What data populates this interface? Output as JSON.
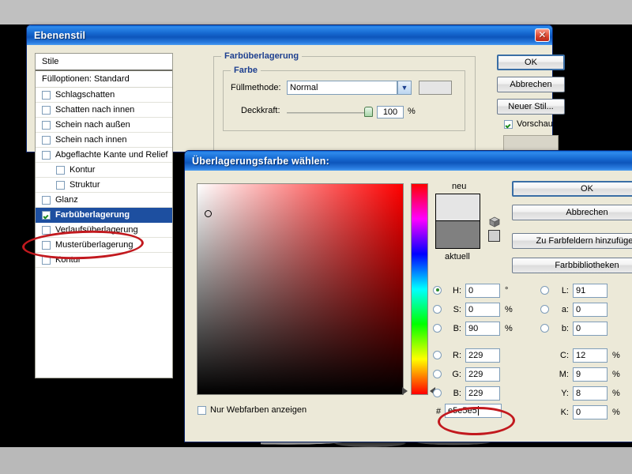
{
  "desktop": {
    "background_color": "#000000",
    "band_color": "#c0c0c0"
  },
  "layer_style_dialog": {
    "title": "Ebenenstil",
    "close_label": "✕",
    "styles_list": {
      "header": "Stile",
      "blending": "Fülloptionen: Standard",
      "items": [
        {
          "label": "Schlagschatten",
          "checked": false,
          "indent": false,
          "selected": false
        },
        {
          "label": "Schatten nach innen",
          "checked": false,
          "indent": false,
          "selected": false
        },
        {
          "label": "Schein nach außen",
          "checked": false,
          "indent": false,
          "selected": false
        },
        {
          "label": "Schein nach innen",
          "checked": false,
          "indent": false,
          "selected": false
        },
        {
          "label": "Abgeflachte Kante und Relief",
          "checked": false,
          "indent": false,
          "selected": false
        },
        {
          "label": "Kontur",
          "checked": false,
          "indent": true,
          "selected": false
        },
        {
          "label": "Struktur",
          "checked": false,
          "indent": true,
          "selected": false
        },
        {
          "label": "Glanz",
          "checked": false,
          "indent": false,
          "selected": false
        },
        {
          "label": "Farbüberlagerung",
          "checked": true,
          "indent": false,
          "selected": true
        },
        {
          "label": "Verlaufsüberlagerung",
          "checked": false,
          "indent": false,
          "selected": false
        },
        {
          "label": "Musterüberlagerung",
          "checked": false,
          "indent": false,
          "selected": false
        },
        {
          "label": "Kontur",
          "checked": false,
          "indent": false,
          "selected": false
        }
      ]
    },
    "panel": {
      "group_title": "Farbüberlagerung",
      "subgroup_title": "Farbe",
      "blend_mode_label": "Füllmethode:",
      "blend_mode_value": "Normal",
      "color_swatch": "#e5e5e5",
      "opacity_label": "Deckkraft:",
      "opacity_value": "100",
      "opacity_unit": "%"
    },
    "buttons": {
      "ok": "OK",
      "cancel": "Abbrechen",
      "new_style": "Neuer Stil...",
      "preview_label": "Vorschau",
      "preview_checked": true
    }
  },
  "color_picker_dialog": {
    "title": "Überlagerungsfarbe wählen:",
    "preview": {
      "new_label": "neu",
      "current_label": "aktuell",
      "new_color": "#e5e5e5",
      "current_color": "#808080",
      "gamut_warning_icon": "cube-icon",
      "gamut_swatch": "#d0d0d0"
    },
    "buttons": {
      "ok": "OK",
      "cancel": "Abbrechen",
      "add_swatch": "Zu Farbfeldern hinzufügen",
      "libraries": "Farbbibliotheken"
    },
    "web_colors_label": "Nur Webfarben anzeigen",
    "web_colors_checked": false,
    "hex_prefix": "#",
    "hex_value": "e5e5e5",
    "fields": [
      {
        "key": "H",
        "label": "H:",
        "value": "0",
        "unit": "°",
        "radio": true,
        "selected": true
      },
      {
        "key": "S",
        "label": "S:",
        "value": "0",
        "unit": "%",
        "radio": true,
        "selected": false
      },
      {
        "key": "B",
        "label": "B:",
        "value": "90",
        "unit": "%",
        "radio": true,
        "selected": false
      },
      {
        "key": "R",
        "label": "R:",
        "value": "229",
        "unit": "",
        "radio": true,
        "selected": false
      },
      {
        "key": "G",
        "label": "G:",
        "value": "229",
        "unit": "",
        "radio": true,
        "selected": false
      },
      {
        "key": "B2",
        "label": "B:",
        "value": "229",
        "unit": "",
        "radio": true,
        "selected": false
      }
    ],
    "fields_right": [
      {
        "key": "L",
        "label": "L:",
        "value": "91",
        "unit": "",
        "radio": true,
        "selected": false
      },
      {
        "key": "a",
        "label": "a:",
        "value": "0",
        "unit": "",
        "radio": true,
        "selected": false
      },
      {
        "key": "b",
        "label": "b:",
        "value": "0",
        "unit": "",
        "radio": true,
        "selected": false
      },
      {
        "key": "C",
        "label": "C:",
        "value": "12",
        "unit": "%",
        "radio": false,
        "selected": false
      },
      {
        "key": "M",
        "label": "M:",
        "value": "9",
        "unit": "%",
        "radio": false,
        "selected": false
      },
      {
        "key": "Y",
        "label": "Y:",
        "value": "8",
        "unit": "%",
        "radio": false,
        "selected": false
      },
      {
        "key": "K",
        "label": "K:",
        "value": "0",
        "unit": "%",
        "radio": false,
        "selected": false
      }
    ]
  },
  "annotations": {
    "color": "#c2191e"
  }
}
